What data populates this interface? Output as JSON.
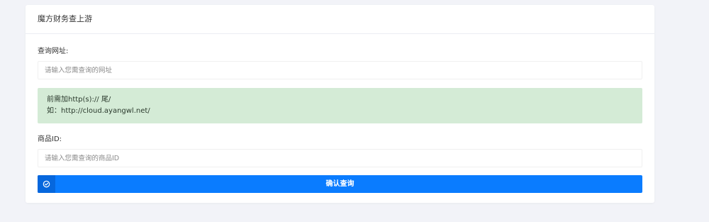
{
  "card": {
    "title": "魔方财务查上游"
  },
  "form": {
    "url_label": "查询网址:",
    "url_placeholder": "请输入您需查询的网址",
    "tip_line1": "前需加http(s):// 尾/",
    "tip_line2": "如：http://cloud.ayangwl.net/",
    "product_label": "商品ID:",
    "product_placeholder": "请输入您需查询的商品ID",
    "submit_label": "确认查询",
    "submit_icon": "check-circle-icon"
  },
  "colors": {
    "page_bg": "#f2f3f8",
    "card_bg": "#ffffff",
    "tip_bg": "#d4ebd6",
    "button": "#0a7cff",
    "button_icon_bg": "#0667dd"
  }
}
